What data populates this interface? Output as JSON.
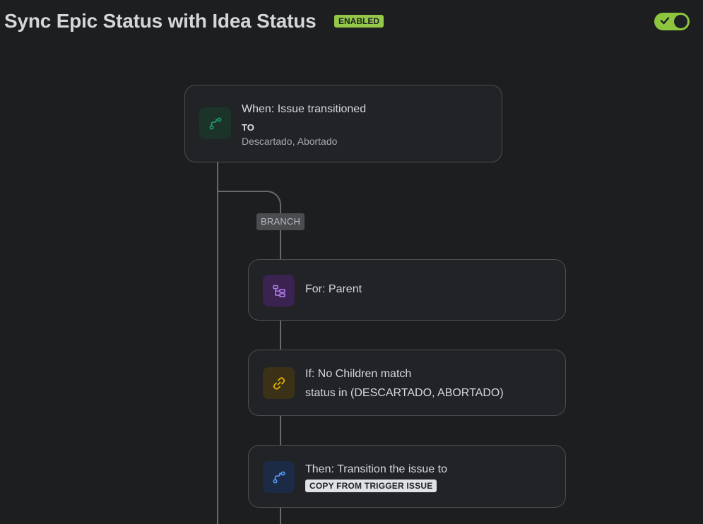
{
  "header": {
    "title": "Sync Epic Status with Idea Status",
    "status_badge": "ENABLED",
    "toggle": {
      "on": true,
      "icon": "check-icon"
    }
  },
  "flow": {
    "trigger": {
      "icon": "transition-icon",
      "title": "When: Issue transitioned",
      "label": "TO",
      "value": "Descartado, Abortado"
    },
    "branch_label": "BRANCH",
    "for_step": {
      "icon": "hierarchy-icon",
      "title": "For: Parent"
    },
    "condition": {
      "icon": "link-icon",
      "title": "If: No Children match",
      "detail": "status in (DESCARTADO, ABORTADO)"
    },
    "action": {
      "icon": "transition-icon",
      "title": "Then: Transition the issue to",
      "chip": "COPY FROM TRIGGER ISSUE"
    }
  },
  "colors": {
    "background": "#1d1e20",
    "accent_green": "#94c748",
    "trigger_icon": "#22a06b",
    "branch_icon": "#b57cf0",
    "condition_icon": "#e2b203",
    "action_icon": "#579dff"
  }
}
